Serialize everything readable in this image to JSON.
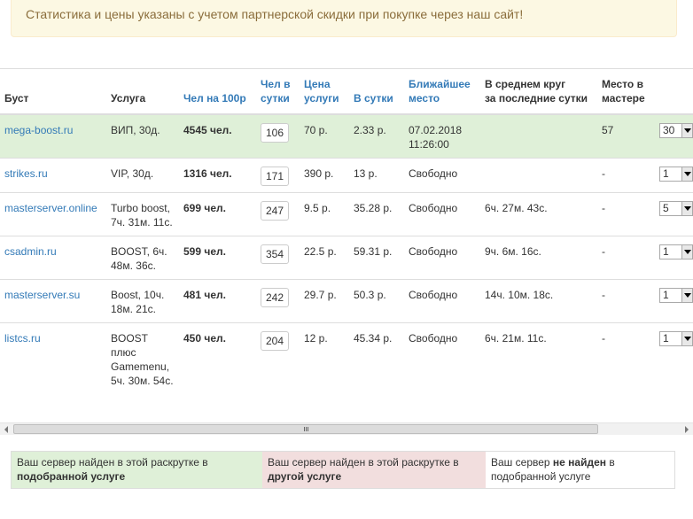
{
  "notice": "Статистика и цены указаны с учетом партнерской скидки при покупке через наш сайт!",
  "table": {
    "headers": {
      "boost": "Буст",
      "service": "Услуга",
      "per100": "Чел на 100р",
      "perday_line1": "Чел в",
      "perday_line2": "сутки",
      "price_line1": "Цена",
      "price_line2": "услуги",
      "inday": "В сутки",
      "nearest_line1": "Ближайшее",
      "nearest_line2": "место",
      "avg_line1": "В среднем круг",
      "avg_line2": "за последние сутки",
      "place_line1": "Место в",
      "place_line2": "мастере"
    },
    "rows": [
      {
        "site": "mega-boost.ru",
        "service": "ВИП, 30д.",
        "per100": "4545 чел.",
        "perday": "106",
        "price": "70 р.",
        "inday": "2.33 р.",
        "nearest": "07.02.2018 11:26:00",
        "avg": "",
        "place": "57",
        "select": "30",
        "highlight": true
      },
      {
        "site": "strikes.ru",
        "service": "VIP, 30д.",
        "per100": "1316 чел.",
        "perday": "171",
        "price": "390 р.",
        "inday": "13 р.",
        "nearest": "Свободно",
        "avg": "",
        "place": "-",
        "select": "1",
        "highlight": false
      },
      {
        "site": "masterserver.online",
        "service": "Turbo boost, 7ч. 31м. 11с.",
        "per100": "699 чел.",
        "perday": "247",
        "price": "9.5 р.",
        "inday": "35.28 р.",
        "nearest": "Свободно",
        "avg": "6ч. 27м. 43с.",
        "place": "-",
        "select": "5",
        "highlight": false
      },
      {
        "site": "csadmin.ru",
        "service": "BOOST, 6ч. 48м. 36с.",
        "per100": "599 чел.",
        "perday": "354",
        "price": "22.5 р.",
        "inday": "59.31 р.",
        "nearest": "Свободно",
        "avg": "9ч. 6м. 16с.",
        "place": "-",
        "select": "1",
        "highlight": false
      },
      {
        "site": "masterserver.su",
        "service": "Boost, 10ч. 18м. 21с.",
        "per100": "481 чел.",
        "perday": "242",
        "price": "29.7 р.",
        "inday": "50.3 р.",
        "nearest": "Свободно",
        "avg": "14ч. 10м. 18с.",
        "place": "-",
        "select": "1",
        "highlight": false
      },
      {
        "site": "listcs.ru",
        "service": "BOOST плюс Gamemenu, 5ч. 30м. 54с.",
        "per100": "450 чел.",
        "perday": "204",
        "price": "12 р.",
        "inday": "45.34 р.",
        "nearest": "Свободно",
        "avg": "6ч. 21м. 11с.",
        "place": "-",
        "select": "1",
        "highlight": false
      }
    ]
  },
  "legend": {
    "found_prefix": "Ваш сервер найден в этой раскрутке в",
    "found_bold": "подобранной услуге",
    "other_prefix": "Ваш сервер найден в этой раскрутке в",
    "other_bold": "другой услуге",
    "notfound_prefix": "Ваш сервер",
    "notfound_bold": "не найден",
    "notfound_suffix": "в подобранной услуге"
  },
  "colors": {
    "highlight_row": "#dff0d8",
    "other_service": "#f2dede",
    "notice_bg": "#fcf8e3",
    "link": "#337ab7"
  },
  "icons": {
    "select_arrow": "chevron-down-icon",
    "scroll_left": "arrow-left-icon",
    "scroll_right": "arrow-right-icon"
  }
}
